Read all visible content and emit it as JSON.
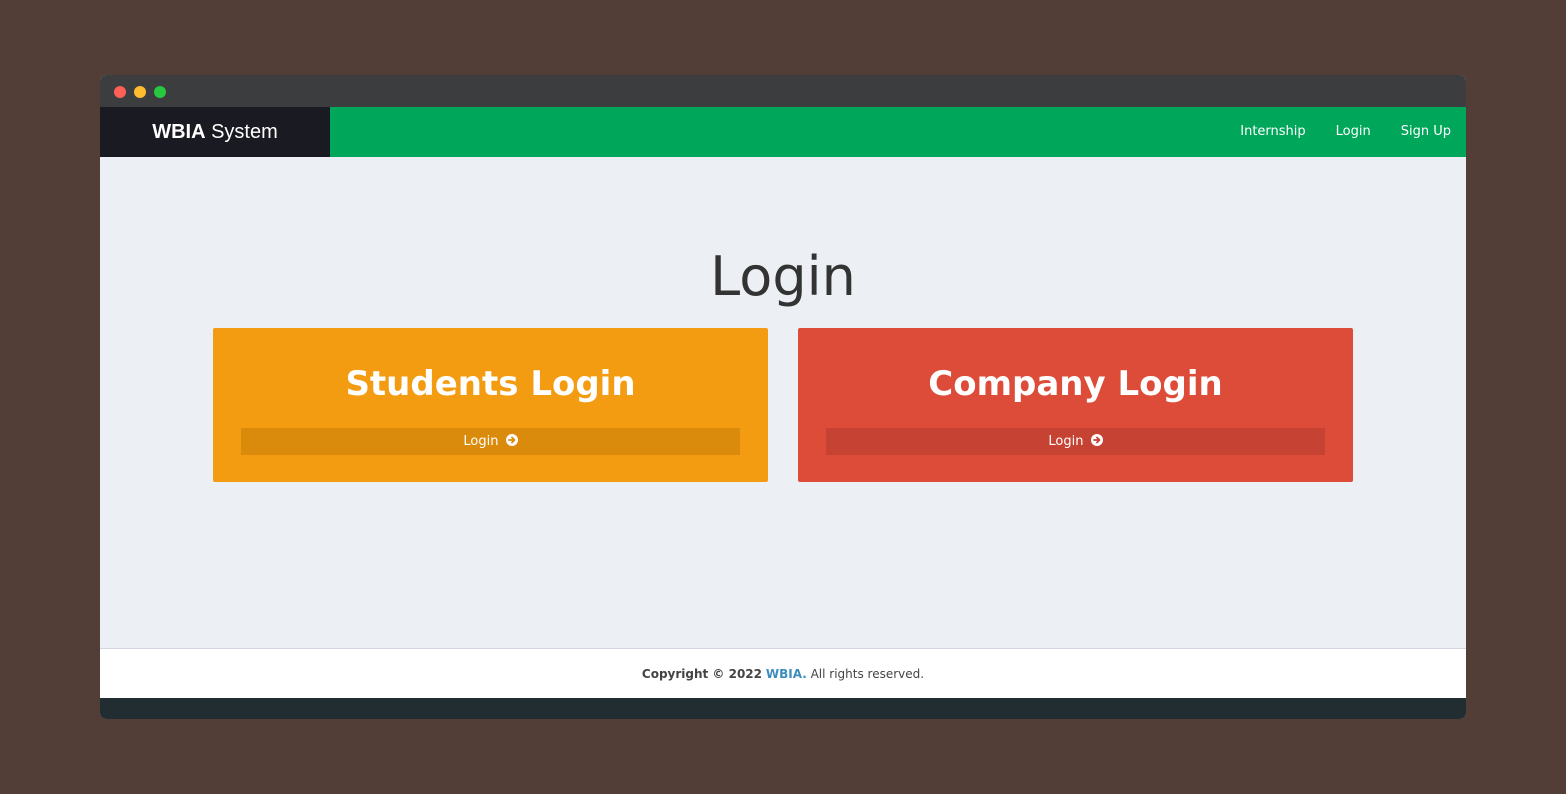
{
  "brand": {
    "bold": "WBIA",
    "rest": " System"
  },
  "nav": {
    "items": [
      {
        "label": "Internship"
      },
      {
        "label": "Login"
      },
      {
        "label": "Sign Up"
      }
    ]
  },
  "main": {
    "title": "Login",
    "cards": [
      {
        "title": "Students Login",
        "button_label": "Login",
        "color": "#f39c12",
        "button_color": "#db8b0b",
        "icon": "arrow-circle-right-icon"
      },
      {
        "title": "Company Login",
        "button_label": "Login",
        "color": "#dd4b39",
        "button_color": "#c64333",
        "icon": "arrow-circle-right-icon"
      }
    ]
  },
  "footer": {
    "prefix": "Copyright © 2022",
    "link": "WBIA.",
    "suffix": "All rights reserved."
  },
  "colors": {
    "navbar": "#00a65a",
    "brand_bg": "#1a1a22",
    "content_bg": "#ecf0f5",
    "outer_bg": "#523d37"
  }
}
